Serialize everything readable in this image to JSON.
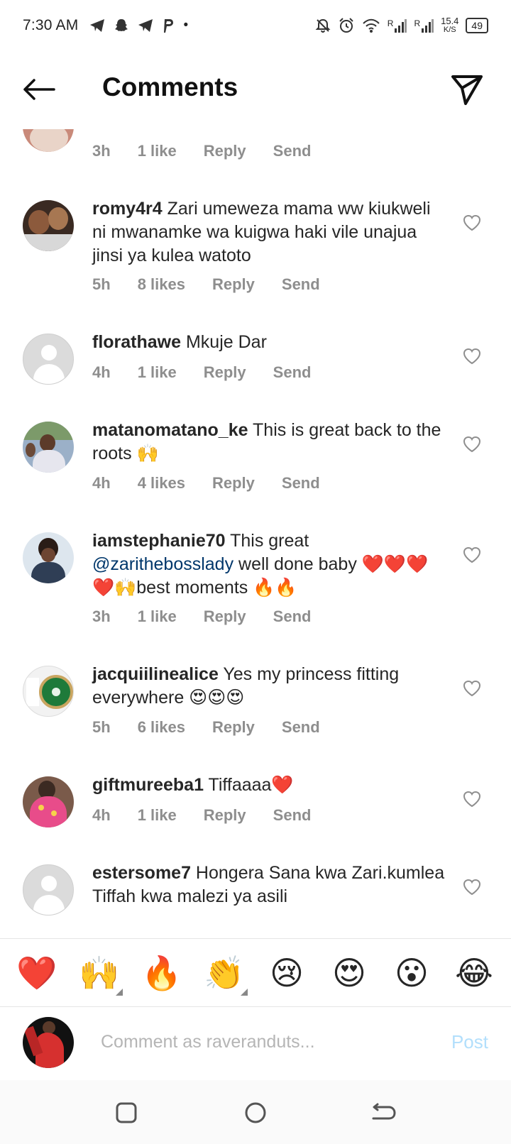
{
  "status_bar": {
    "time": "7:30 AM",
    "app_icons": [
      "telegram-icon",
      "snapchat-icon",
      "telegram-icon",
      "pinterest-icon"
    ],
    "dot": "•",
    "net_speed_value": "15.4",
    "net_speed_unit": "K/S",
    "signal_label_1": "R",
    "signal_label_2": "R",
    "battery": "49"
  },
  "header": {
    "title": "Comments"
  },
  "comments": [
    {
      "username": "",
      "text": "",
      "time": "3h",
      "likes": "1 like",
      "reply": "Reply",
      "send": "Send"
    },
    {
      "username": "romy4r4",
      "text": " Zari umeweza mama ww kiukweli ni mwanamke wa kuigwa haki vile unajua jinsi ya kulea watoto",
      "time": "5h",
      "likes": "8 likes",
      "reply": "Reply",
      "send": "Send"
    },
    {
      "username": "florathawe",
      "text": " Mkuje Dar",
      "time": "4h",
      "likes": "1 like",
      "reply": "Reply",
      "send": "Send"
    },
    {
      "username": "matanomatano_ke",
      "text": " This is great back to the roots 🙌",
      "time": "4h",
      "likes": "4 likes",
      "reply": "Reply",
      "send": "Send"
    },
    {
      "username": "iamstephanie70",
      "text_before": " This great ",
      "mention": "@zarithebosslady",
      "text_after": " well done baby ❤️❤️❤️❤️🙌best moments 🔥🔥",
      "time": "3h",
      "likes": "1 like",
      "reply": "Reply",
      "send": "Send"
    },
    {
      "username": "jacquiilinealice",
      "text": " Yes my princess fitting everywhere 😍😍😍",
      "time": "5h",
      "likes": "6 likes",
      "reply": "Reply",
      "send": "Send"
    },
    {
      "username": "giftmureeba1",
      "text": " Tiffaaaa❤️",
      "time": "4h",
      "likes": "1 like",
      "reply": "Reply",
      "send": "Send"
    },
    {
      "username": "estersome7",
      "text": " Hongera Sana kwa Zari.kumlea Tiffah kwa malezi ya asili"
    }
  ],
  "reactions": [
    "❤️",
    "🙌",
    "🔥",
    "👏",
    "😢",
    "😍",
    "😮",
    "😂"
  ],
  "composer": {
    "placeholder": "Comment as raveranduts...",
    "post_label": "Post"
  },
  "colors": {
    "text": "#262626",
    "meta": "#8e8e8e",
    "mention": "#00376b",
    "post_disabled": "#b2dffc",
    "placeholder_avatar": "#dbdbdb"
  }
}
